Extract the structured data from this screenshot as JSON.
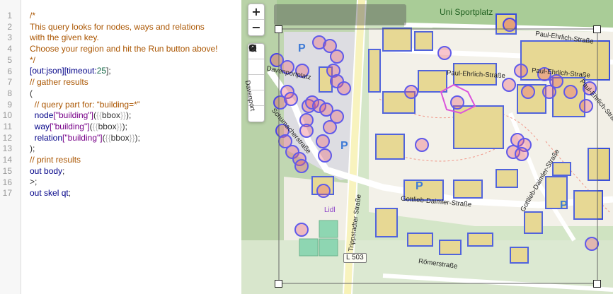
{
  "editor": {
    "line_numbers": [
      "1",
      "2",
      "3",
      "4",
      "5",
      "6",
      "7",
      "8",
      "9",
      "10",
      "11",
      "12",
      "13",
      "14",
      "15",
      "16",
      "17"
    ],
    "lines": [
      [
        {
          "t": "/*",
          "c": "comment"
        }
      ],
      [
        {
          "t": "This query looks for nodes, ways and relations",
          "c": "comment"
        }
      ],
      [
        {
          "t": "with the given key.",
          "c": "comment"
        }
      ],
      [
        {
          "t": "Choose your region and hit the Run button above!",
          "c": "comment"
        }
      ],
      [
        {
          "t": "*/",
          "c": "comment"
        }
      ],
      [
        {
          "t": "[out:json][timeout:",
          "c": "kw"
        },
        {
          "t": "25",
          "c": "num"
        },
        {
          "t": "];",
          "c": "plain"
        }
      ],
      [
        {
          "t": "// gather results",
          "c": "comment"
        }
      ],
      [
        {
          "t": "(",
          "c": "plain"
        }
      ],
      [
        {
          "t": "  // query part for: “building=*”",
          "c": "comment"
        }
      ],
      [
        {
          "t": "  node",
          "c": "kw"
        },
        {
          "t": "[\"building\"]",
          "c": "tag"
        },
        {
          "t": "(",
          "c": "plain"
        },
        {
          "t": "{{",
          "c": "tpl"
        },
        {
          "t": "bbox",
          "c": "plain"
        },
        {
          "t": "}}",
          "c": "tpl"
        },
        {
          "t": ");",
          "c": "plain"
        }
      ],
      [
        {
          "t": "  way",
          "c": "kw"
        },
        {
          "t": "[\"building\"]",
          "c": "tag"
        },
        {
          "t": "(",
          "c": "plain"
        },
        {
          "t": "{{",
          "c": "tpl"
        },
        {
          "t": "bbox",
          "c": "plain"
        },
        {
          "t": "}}",
          "c": "tpl"
        },
        {
          "t": ");",
          "c": "plain"
        }
      ],
      [
        {
          "t": "  relation",
          "c": "kw"
        },
        {
          "t": "[\"building\"]",
          "c": "tag"
        },
        {
          "t": "(",
          "c": "plain"
        },
        {
          "t": "{{",
          "c": "tpl"
        },
        {
          "t": "bbox",
          "c": "plain"
        },
        {
          "t": "}}",
          "c": "tpl"
        },
        {
          "t": ");",
          "c": "plain"
        }
      ],
      [
        {
          "t": ");",
          "c": "plain"
        }
      ],
      [
        {
          "t": "// print results",
          "c": "comment"
        }
      ],
      [
        {
          "t": "out body",
          "c": "kw"
        },
        {
          "t": ";",
          "c": "plain"
        }
      ],
      [
        {
          "t": ">;",
          "c": "plain"
        }
      ],
      [
        {
          "t": "out skel qt",
          "c": "kw"
        },
        {
          "t": ";",
          "c": "plain"
        }
      ]
    ]
  },
  "map": {
    "controls": {
      "zoom_in": "+",
      "zoom_out": "−",
      "search_icon": "search-icon",
      "current_location_icon": "target-icon",
      "manual_bbox_icon": "bbox-icon",
      "zoom_to_data_icon": "zoom-to-data-icon",
      "clear_icon": "no-entry-icon"
    },
    "labels": {
      "park": "Uni Sportplatz",
      "paul_ehrlich_1": "Paul-Ehrlich-Straße",
      "paul_ehrlich_2": "Paul-Ehrlich-Straße",
      "paul_ehrlich_3": "Paul-Ehrlich-Straße",
      "paul_ehrlich_4": "Paul-Ehrlich-Straße",
      "davenport": "Davenportplatz",
      "davenport_2": "Davenport",
      "schumacher": "Schumacherstraße",
      "trippstadter": "Trippstadter Straße",
      "gottlieb_1": "Gottlieb-Daimler-Straße",
      "gottlieb_2": "Gottlieb-Daimler-Straße",
      "romer": "Römerstraße",
      "lidl": "Lidl",
      "road_sign": "L 503",
      "parking_symbol": "P"
    },
    "colors": {
      "building_outline": "#3a4fd8",
      "match_circle": "#4a44e8",
      "match_fill": "#e8445f",
      "highlight_outline": "#d63cd6"
    }
  }
}
